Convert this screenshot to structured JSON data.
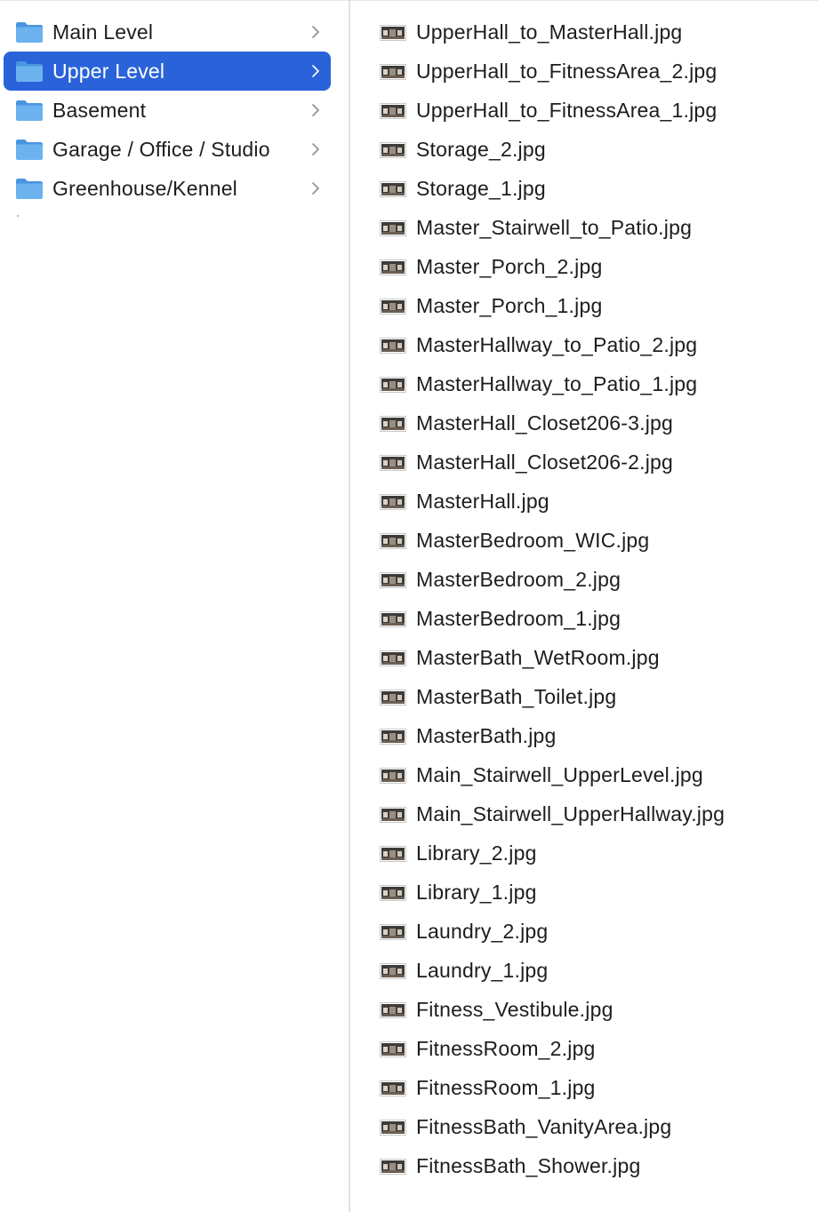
{
  "colors": {
    "selection": "#2a63d9",
    "folder_blue": "#62a9ea",
    "text": "#1d1d1f",
    "divider": "#e2e2e2"
  },
  "folders": [
    {
      "label": "Main Level",
      "selected": false,
      "icon": "folder-icon",
      "chevron": "chevron-right-icon"
    },
    {
      "label": "Upper Level",
      "selected": true,
      "icon": "folder-icon",
      "chevron": "chevron-right-icon"
    },
    {
      "label": "Basement",
      "selected": false,
      "icon": "folder-icon",
      "chevron": "chevron-right-icon"
    },
    {
      "label": "Garage / Office / Studio",
      "selected": false,
      "icon": "folder-icon",
      "chevron": "chevron-right-icon"
    },
    {
      "label": "Greenhouse/Kennel",
      "selected": false,
      "icon": "folder-icon",
      "chevron": "chevron-right-icon"
    }
  ],
  "files": [
    {
      "name": "UpperHall_to_MasterHall.jpg",
      "icon": "jpg-thumbnail-icon"
    },
    {
      "name": "UpperHall_to_FitnessArea_2.jpg",
      "icon": "jpg-thumbnail-icon"
    },
    {
      "name": "UpperHall_to_FitnessArea_1.jpg",
      "icon": "jpg-thumbnail-icon"
    },
    {
      "name": "Storage_2.jpg",
      "icon": "jpg-thumbnail-icon"
    },
    {
      "name": "Storage_1.jpg",
      "icon": "jpg-thumbnail-icon"
    },
    {
      "name": "Master_Stairwell_to_Patio.jpg",
      "icon": "jpg-thumbnail-icon"
    },
    {
      "name": "Master_Porch_2.jpg",
      "icon": "jpg-thumbnail-icon"
    },
    {
      "name": "Master_Porch_1.jpg",
      "icon": "jpg-thumbnail-icon"
    },
    {
      "name": "MasterHallway_to_Patio_2.jpg",
      "icon": "jpg-thumbnail-icon"
    },
    {
      "name": "MasterHallway_to_Patio_1.jpg",
      "icon": "jpg-thumbnail-icon"
    },
    {
      "name": "MasterHall_Closet206-3.jpg",
      "icon": "jpg-thumbnail-icon"
    },
    {
      "name": "MasterHall_Closet206-2.jpg",
      "icon": "jpg-thumbnail-icon"
    },
    {
      "name": "MasterHall.jpg",
      "icon": "jpg-thumbnail-icon"
    },
    {
      "name": "MasterBedroom_WIC.jpg",
      "icon": "jpg-thumbnail-icon"
    },
    {
      "name": "MasterBedroom_2.jpg",
      "icon": "jpg-thumbnail-icon"
    },
    {
      "name": "MasterBedroom_1.jpg",
      "icon": "jpg-thumbnail-icon"
    },
    {
      "name": "MasterBath_WetRoom.jpg",
      "icon": "jpg-thumbnail-icon"
    },
    {
      "name": "MasterBath_Toilet.jpg",
      "icon": "jpg-thumbnail-icon"
    },
    {
      "name": "MasterBath.jpg",
      "icon": "jpg-thumbnail-icon"
    },
    {
      "name": "Main_Stairwell_UpperLevel.jpg",
      "icon": "jpg-thumbnail-icon"
    },
    {
      "name": "Main_Stairwell_UpperHallway.jpg",
      "icon": "jpg-thumbnail-icon"
    },
    {
      "name": "Library_2.jpg",
      "icon": "jpg-thumbnail-icon"
    },
    {
      "name": "Library_1.jpg",
      "icon": "jpg-thumbnail-icon"
    },
    {
      "name": "Laundry_2.jpg",
      "icon": "jpg-thumbnail-icon"
    },
    {
      "name": "Laundry_1.jpg",
      "icon": "jpg-thumbnail-icon"
    },
    {
      "name": "Fitness_Vestibule.jpg",
      "icon": "jpg-thumbnail-icon"
    },
    {
      "name": "FitnessRoom_2.jpg",
      "icon": "jpg-thumbnail-icon"
    },
    {
      "name": "FitnessRoom_1.jpg",
      "icon": "jpg-thumbnail-icon"
    },
    {
      "name": "FitnessBath_VanityArea.jpg",
      "icon": "jpg-thumbnail-icon"
    },
    {
      "name": "FitnessBath_Shower.jpg",
      "icon": "jpg-thumbnail-icon"
    }
  ]
}
